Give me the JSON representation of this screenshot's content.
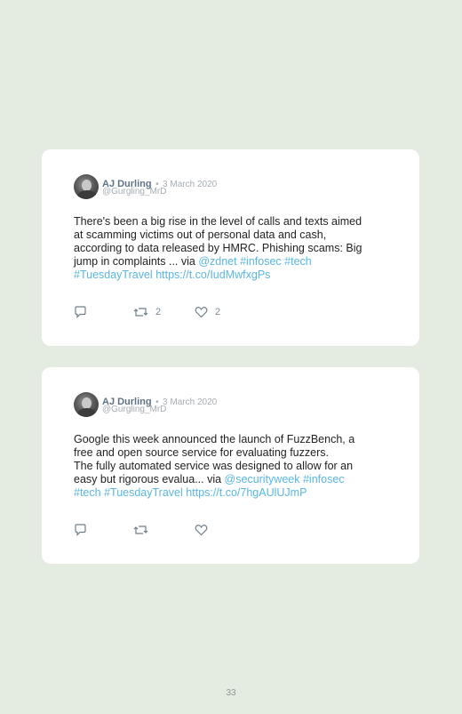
{
  "tweets": [
    {
      "author": "AJ Durling",
      "separator": "•",
      "date": "3 March 2020",
      "handle": "@Gurgling_MrD",
      "text_lines": [
        [
          {
            "t": "There's been a big rise in the level of calls and texts aimed"
          }
        ],
        [
          {
            "t": "at scamming victims out of personal data and cash,"
          }
        ],
        [
          {
            "t": "according to data released by HMRC. Phishing scams: Big"
          }
        ],
        [
          {
            "t": "jump in complaints ... via "
          },
          {
            "t": "@zdnet",
            "link": true
          },
          {
            "t": " "
          },
          {
            "t": "#infosec",
            "link": true
          },
          {
            "t": " "
          },
          {
            "t": "#tech",
            "link": true
          }
        ],
        [
          {
            "t": "#TuesdayTravel",
            "link": true
          },
          {
            "t": " "
          },
          {
            "t": "https://t.co/IudMwfxgPs",
            "link": true
          }
        ]
      ],
      "actions": {
        "reply_icon": "reply-icon",
        "retweet_icon": "retweet-icon",
        "retweet_count": "2",
        "like_icon": "heart-icon",
        "like_count": "2"
      }
    },
    {
      "author": "AJ Durling",
      "separator": "•",
      "date": "3 March 2020",
      "handle": "@Gurgling_MrD",
      "text_lines": [
        [
          {
            "t": "Google this week announced the launch of FuzzBench, a"
          }
        ],
        [
          {
            "t": "free and open source service for evaluating fuzzers."
          }
        ],
        [
          {
            "t": "The fully automated service was designed to allow for an"
          }
        ],
        [
          {
            "t": "easy but rigorous evalua... via "
          },
          {
            "t": "@securityweek",
            "link": true
          },
          {
            "t": " "
          },
          {
            "t": "#infosec",
            "link": true
          }
        ],
        [
          {
            "t": "#tech",
            "link": true
          },
          {
            "t": " "
          },
          {
            "t": "#TuesdayTravel",
            "link": true
          },
          {
            "t": " "
          },
          {
            "t": "https://t.co/7hgAUlUJmP",
            "link": true
          }
        ]
      ],
      "actions": {
        "reply_icon": "reply-icon",
        "retweet_icon": "retweet-icon",
        "retweet_count": "",
        "like_icon": "heart-icon",
        "like_count": ""
      }
    }
  ],
  "page_number": "33",
  "colors": {
    "background": "#e4ece2",
    "card": "#ffffff",
    "link": "#5ab6e2",
    "author": "#5f7386",
    "muted": "#a5adb3"
  }
}
